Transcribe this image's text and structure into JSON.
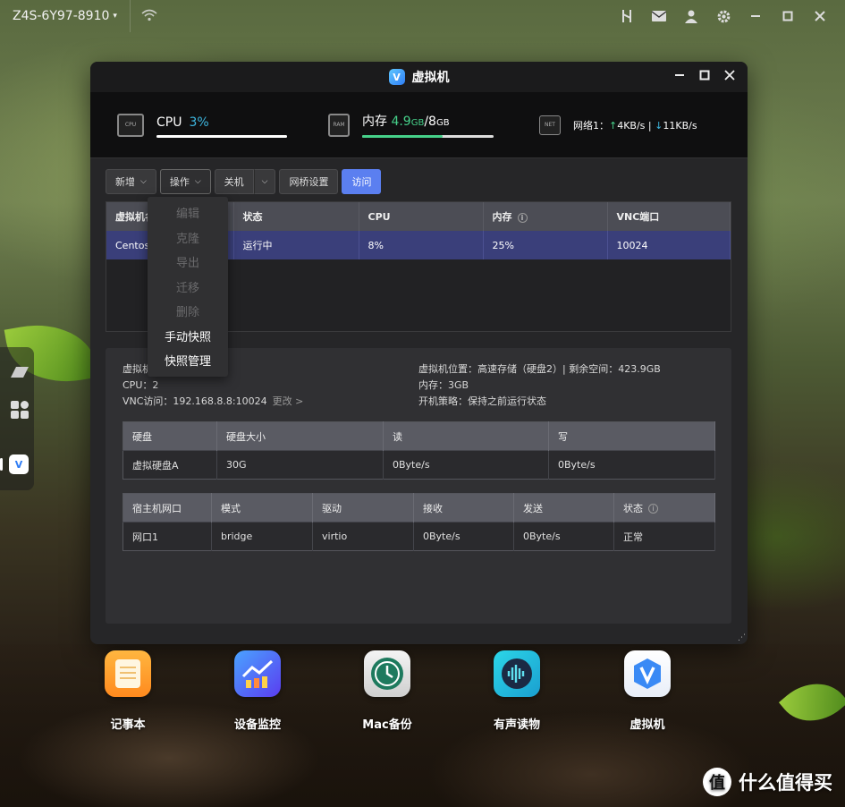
{
  "topbar": {
    "host": "Z4S-6Y97-8910"
  },
  "window": {
    "title": "虚拟机"
  },
  "stats": {
    "cpu_label": "CPU",
    "cpu_value": "3%",
    "cpu_fraction": 0.03,
    "mem_label": "内存",
    "mem_used": "4.9",
    "mem_unit1": "GB",
    "mem_sep": "/",
    "mem_total": "8",
    "mem_unit2": "GB",
    "mem_fraction": 0.61,
    "net_label": "网络1：",
    "net_up_arrow": "↑",
    "net_up": "4KB/s",
    "net_sep": "|",
    "net_down_arrow": "↓",
    "net_down": "11KB/s",
    "chip_cpu": "CPU",
    "chip_ram": "RAM",
    "chip_net": "NET"
  },
  "toolbar": {
    "add": "新增",
    "ops": "操作",
    "shutdown": "关机",
    "bridge": "网桥设置",
    "visit": "访问"
  },
  "vm_table": {
    "headers": [
      "虚拟机名",
      "状态",
      "CPU",
      "内存",
      "VNC端口"
    ],
    "rows": [
      [
        "Centos",
        "运行中",
        "8%",
        "25%",
        "10024"
      ]
    ]
  },
  "menu": {
    "items": [
      {
        "label": "编辑",
        "enabled": false
      },
      {
        "label": "克隆",
        "enabled": false
      },
      {
        "label": "导出",
        "enabled": false
      },
      {
        "label": "迁移",
        "enabled": false
      },
      {
        "label": "删除",
        "enabled": false
      },
      {
        "label": "手动快照",
        "enabled": true
      },
      {
        "label": "快照管理",
        "enabled": true
      }
    ]
  },
  "detail": {
    "name_prefix": "虚拟机",
    "cpu": "CPU：2",
    "vnc": "VNC访问：192.168.8.8:10024",
    "change": "更改 >",
    "location": "虚拟机位置：高速存储（硬盘2）| 剩余空间：423.9GB",
    "memory": "内存：3GB",
    "boot": "开机策略：保持之前运行状态"
  },
  "disk_table": {
    "headers": [
      "硬盘",
      "硬盘大小",
      "读",
      "写"
    ],
    "rows": [
      [
        "虚拟硬盘A",
        "30G",
        "0Byte/s",
        "0Byte/s"
      ]
    ]
  },
  "net_table": {
    "headers": [
      "宿主机网口",
      "模式",
      "驱动",
      "接收",
      "发送",
      "状态"
    ],
    "rows": [
      [
        "网口1",
        "bridge",
        "virtio",
        "0Byte/s",
        "0Byte/s",
        "正常"
      ]
    ]
  },
  "apps": [
    {
      "label": "记事本",
      "icon": "notepad-icon"
    },
    {
      "label": "设备监控",
      "icon": "monitor-chart-icon"
    },
    {
      "label": "Mac备份",
      "icon": "time-machine-icon"
    },
    {
      "label": "有声读物",
      "icon": "audiobook-icon"
    },
    {
      "label": "虚拟机",
      "icon": "virtual-machine-icon"
    }
  ],
  "watermark": {
    "badge": "值",
    "text": "什么值得买"
  },
  "colors": {
    "accent": "#5b7ff0",
    "cpu": "#3db7e0",
    "mem": "#46d18a",
    "selected_row": "#3a3f7a"
  }
}
